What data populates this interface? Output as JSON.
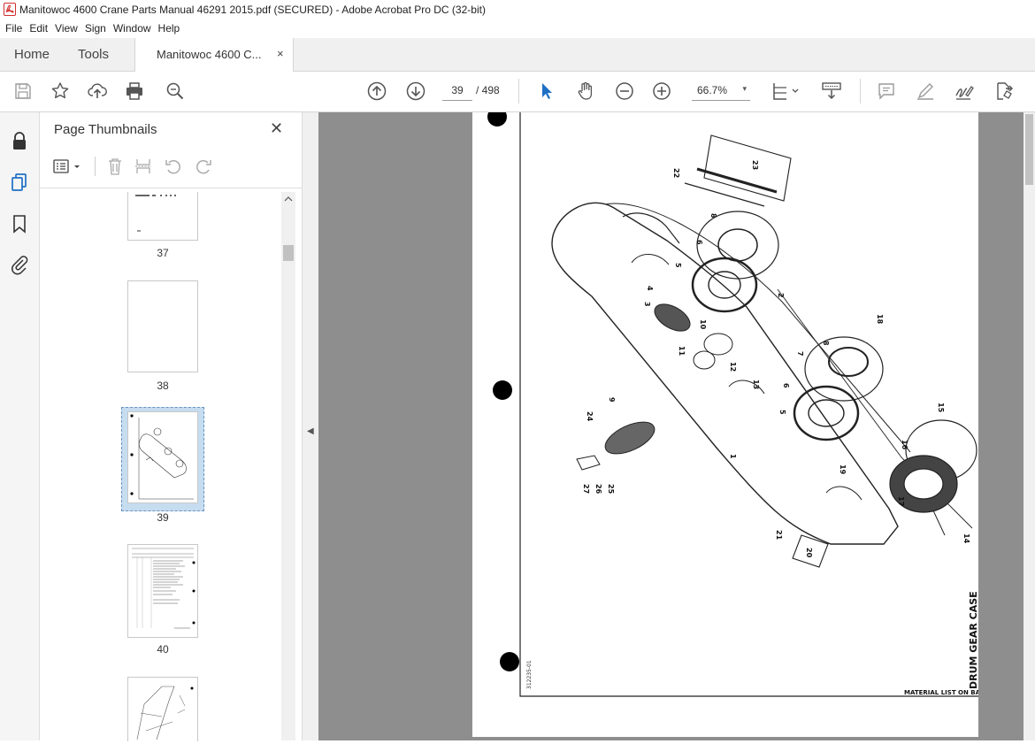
{
  "window": {
    "title": "Manitowoc 4600 Crane Parts Manual 46291 2015.pdf (SECURED) - Adobe Acrobat Pro DC (32-bit)"
  },
  "menu": [
    "File",
    "Edit",
    "View",
    "Sign",
    "Window",
    "Help"
  ],
  "tabs": {
    "home": "Home",
    "tools": "Tools",
    "document": "Manitowoc 4600 C...",
    "close_glyph": "×"
  },
  "toolbar": {
    "current_page": "39",
    "page_total": "/ 498",
    "zoom": "66.7%",
    "zoom_caret": "▾"
  },
  "thumbnails": {
    "header": "Page Thumbnails",
    "close_glyph": "✕",
    "pages": [
      {
        "label": "37"
      },
      {
        "label": "38"
      },
      {
        "label": "39",
        "selected": true
      },
      {
        "label": "40"
      }
    ]
  },
  "drawing": {
    "caption": "DRUM GEAR CASE",
    "footer": "MATERIAL LIST ON BACK",
    "doc_number": "312235-01",
    "callouts": [
      "1",
      "2",
      "3",
      "4",
      "5",
      "5",
      "6",
      "6",
      "7",
      "7",
      "8",
      "8",
      "9",
      "10",
      "11",
      "12",
      "13",
      "14",
      "15",
      "16",
      "17",
      "18",
      "19",
      "20",
      "21",
      "22",
      "23",
      "24",
      "25",
      "26",
      "27"
    ]
  },
  "colors": {
    "accent_blue": "#1f6fc5",
    "pdf_red": "#d32f2f",
    "doc_background": "#8e8e8e",
    "selection": "#c6dcef"
  }
}
